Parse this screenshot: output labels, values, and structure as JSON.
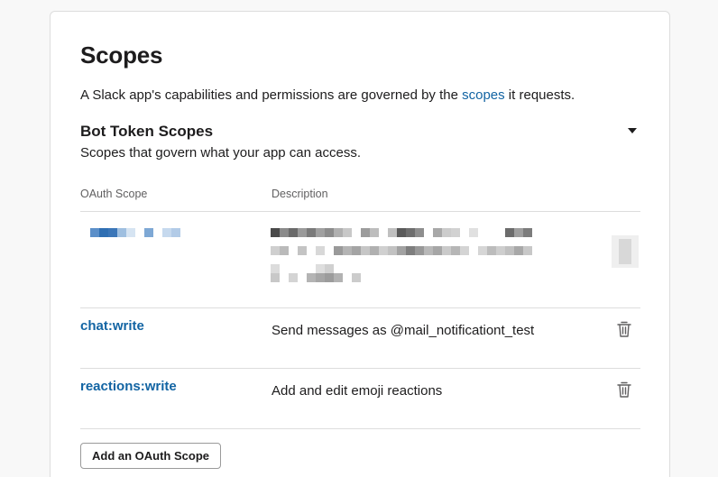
{
  "section": {
    "title": "Scopes",
    "intro_prefix": "A Slack app's capabilities and permissions are governed by the ",
    "intro_link": "scopes",
    "intro_suffix": " it requests."
  },
  "bot_scopes": {
    "title": "Bot Token Scopes",
    "description": "Scopes that govern what your app can access.",
    "columns": [
      "OAuth Scope",
      "Description"
    ],
    "rows": [
      {
        "scope": "chat:write",
        "description": "Send messages as @mail_notificationt_test"
      },
      {
        "scope": "reactions:write",
        "description": "Add and edit emoji reactions"
      }
    ],
    "add_button_label": "Add an OAuth Scope"
  },
  "icons": {
    "collapse": "caret-down-icon",
    "remove": "trash-icon"
  },
  "colors": {
    "link": "#1264a3",
    "text": "#1d1c1d",
    "muted": "#616061",
    "border": "#dddddd"
  }
}
